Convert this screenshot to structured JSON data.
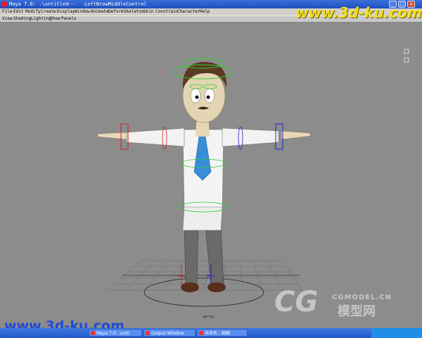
{
  "titlebar": {
    "title": "Maya 7.0: .\\untitled",
    "dashes": "---",
    "selected_object": "LeftBrowMiddleControl",
    "min_label": "_",
    "max_label": "□",
    "close_label": "×"
  },
  "menubar": {
    "items": [
      "File",
      "Edit",
      "Modify",
      "Create",
      "Display",
      "Window",
      "Animate",
      "Deform",
      "Skeleton",
      "Skin",
      "Constrain",
      "Character",
      "Help"
    ]
  },
  "panel_menu": {
    "items": [
      "View",
      "Shading",
      "Lighting",
      "Show",
      "Panels"
    ]
  },
  "viewport": {
    "camera_label": "persp"
  },
  "watermarks": {
    "top": "www.3d-ku.com",
    "bottom": "www.3d-ku.com",
    "logo_cg": "CG",
    "logo_site": "CGMODEL.CN",
    "logo_chinese": "模型网"
  },
  "taskbar": {
    "tasks": [
      "Maya 7.0: .\\unti",
      "Output Window",
      "未命名 - 画图"
    ]
  },
  "colors": {
    "titlebar": "#2a5fd0",
    "menubar": "#d4d0c8",
    "viewport": "#8c8c8c",
    "taskbar": "#2a62d0",
    "watermark_top": "#f0e020",
    "watermark_bottom": "#1e4ad8",
    "tie": "#3a8ed8",
    "controller_green": "#30d030",
    "controller_red": "#d02020",
    "controller_blue": "#2020d0"
  }
}
